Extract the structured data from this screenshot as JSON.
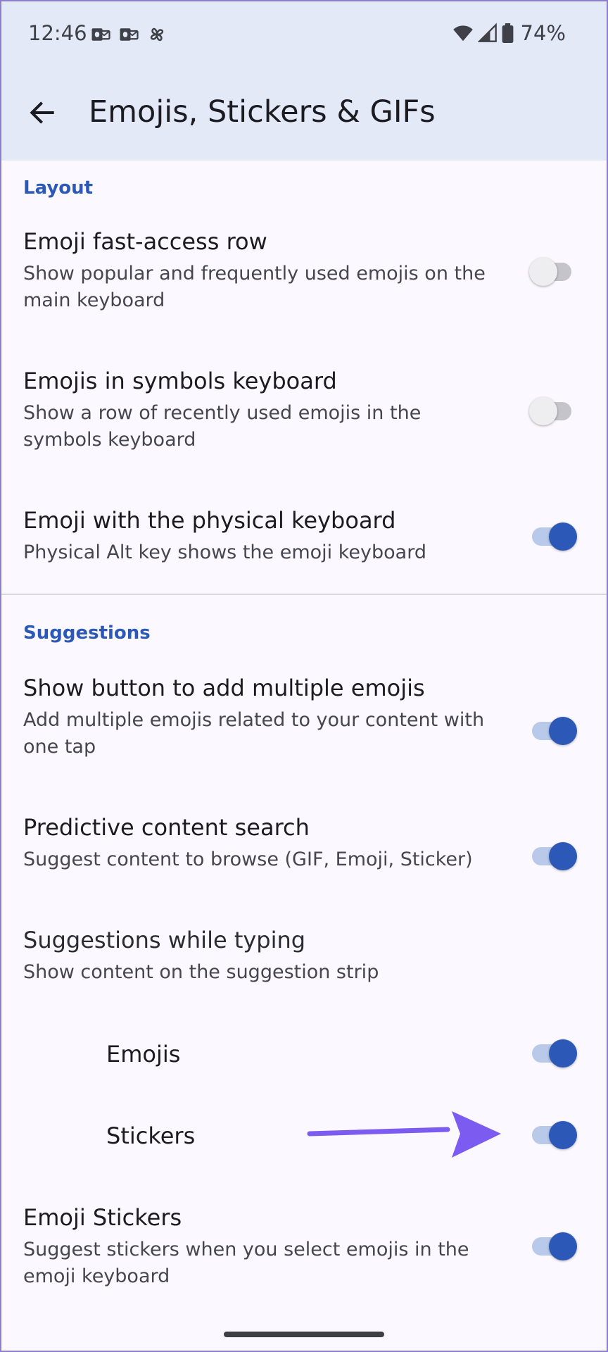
{
  "status_bar": {
    "time": "12:46",
    "notification_icons": [
      "outlook-icon",
      "outlook-icon",
      "pinwheel-icon"
    ],
    "battery_percent": "74%"
  },
  "app_bar": {
    "title": "Emojis, Stickers & GIFs",
    "back_icon": "arrow-back-icon"
  },
  "sections": {
    "layout": {
      "header": "Layout",
      "items": [
        {
          "title": "Emoji fast-access row",
          "summary": "Show popular and frequently used emojis on the main keyboard",
          "enabled": false
        },
        {
          "title": "Emojis in symbols keyboard",
          "summary": "Show a row of recently used emojis in the symbols keyboard",
          "enabled": false
        },
        {
          "title": "Emoji with the physical keyboard",
          "summary": "Physical Alt key shows the emoji keyboard",
          "enabled": true
        }
      ]
    },
    "suggestions": {
      "header": "Suggestions",
      "items": [
        {
          "title": "Show button to add multiple emojis",
          "summary": "Add multiple emojis related to your content with one tap",
          "enabled": true
        },
        {
          "title": "Predictive content search",
          "summary": "Suggest content to browse (GIF, Emoji, Sticker)",
          "enabled": true
        }
      ],
      "typing": {
        "title": "Suggestions while typing",
        "summary": "Show content on the suggestion strip",
        "sub_items": [
          {
            "title": "Emojis",
            "enabled": true
          },
          {
            "title": "Stickers",
            "enabled": true
          }
        ]
      },
      "emoji_stickers": {
        "title": "Emoji Stickers",
        "summary": "Suggest stickers when you select emojis in the emoji keyboard",
        "enabled": true
      }
    }
  },
  "colors": {
    "accent": "#2c59b8",
    "header_bg": "#e3e9f6",
    "annotation_arrow": "#7c5cf0"
  }
}
